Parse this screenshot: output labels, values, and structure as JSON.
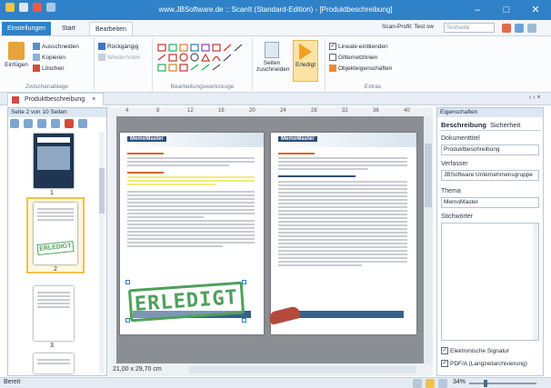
{
  "window": {
    "title": "www.JBSoftware.de  ::  ScanIt (Standard-Edition) - [Produktbeschreibung]",
    "minimize": "–",
    "maximize": "□",
    "close": "✕"
  },
  "ribbon_tabs": {
    "tab1": "Einstellungen",
    "tab2": "Start",
    "tab3": "Bearbeiten",
    "profile_label": "Scan-Profil: Test sw",
    "profile_value": "Testseite"
  },
  "ribbon": {
    "paste": "Einfügen",
    "cut": "Ausschneiden",
    "copy": "Kopieren",
    "delete": "Löschen",
    "clipboard_group": "Zwischenablage",
    "undo": "Rückgängig",
    "redo": "Wiederholen",
    "tools_group": "Bearbeitungswerkzeuge",
    "crop": "Seiten zuschneiden",
    "done": "Erledigt",
    "show_rulers": "Lineale einblenden",
    "gridlines": "Gitternetzlinien",
    "object_props": "Objekteigenschaften",
    "extras_group": "Extras"
  },
  "doc_tab": {
    "label": "Produktbeschreibung",
    "close": "×"
  },
  "thumbs": {
    "header": "Seite 2 von 10 Seiten",
    "pages": [
      "1",
      "2",
      "3"
    ],
    "stamp": "ERLEDIGT"
  },
  "canvas": {
    "stamp": "ERLEDIGT",
    "size_readout": "21,00 x 29,70 cm",
    "ruler_ticks": [
      "4",
      "8",
      "12",
      "16",
      "20",
      "24",
      "28",
      "32",
      "36",
      "40"
    ],
    "brand": "MemoMaster"
  },
  "props": {
    "header": "Eigenschaften",
    "tab_desc": "Beschreibung",
    "tab_security": "Sicherheit",
    "title_label": "Dokumenttitel",
    "title_value": "Produktbeschreibung",
    "author_label": "Verfasser",
    "author_value": "JBSoftware Unternehmensgruppe",
    "subject_label": "Thema",
    "subject_value": "MemoMaster",
    "keywords_label": "Stichwörter",
    "signature": "Elektronische Signatur",
    "pdfa": "PDF/A (Langzeitarchivierung)"
  },
  "status": {
    "left": "Bereit",
    "zoom": "34%"
  }
}
